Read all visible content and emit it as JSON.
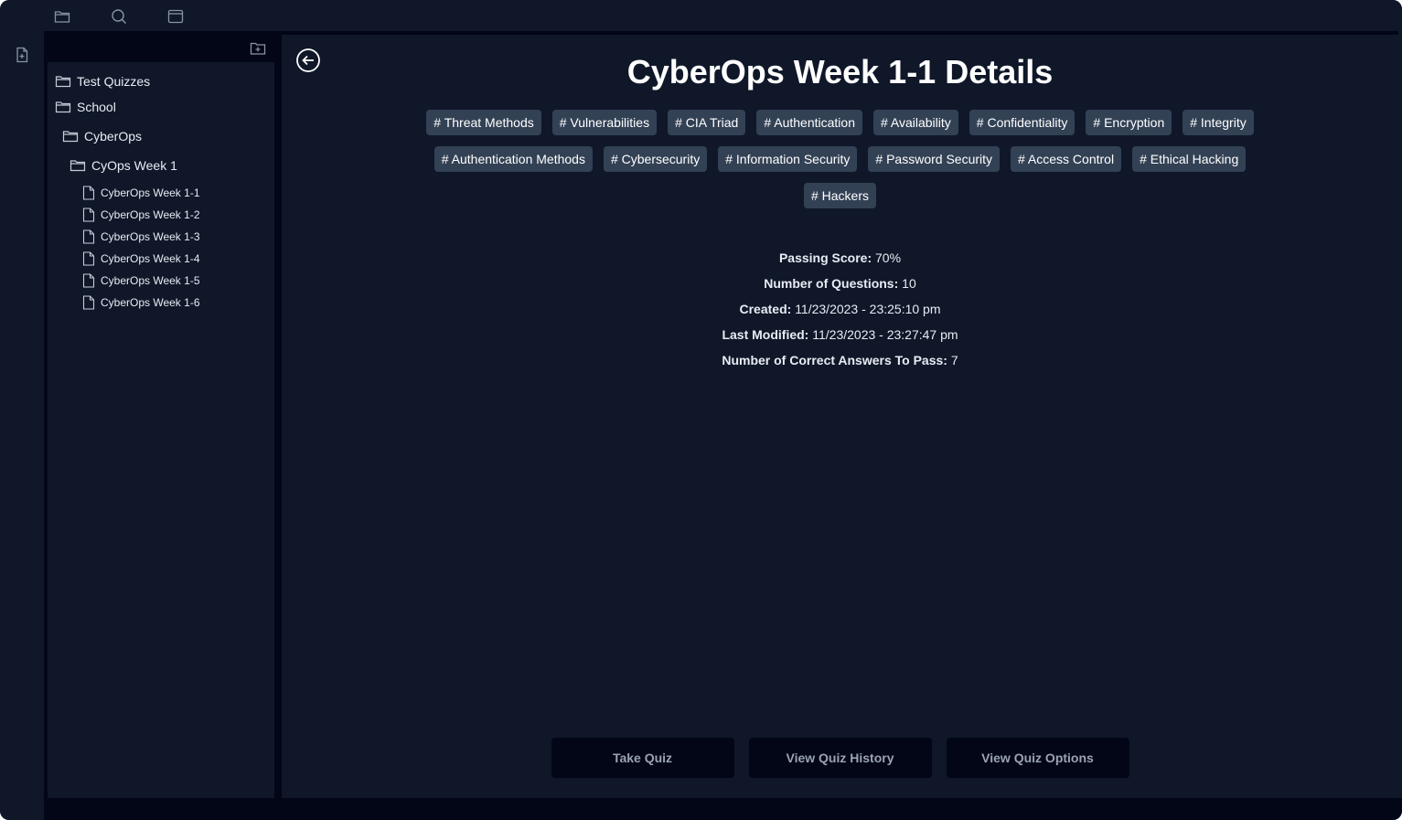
{
  "toolbar": {
    "icons": [
      "folder-icon",
      "search-icon",
      "calendar-icon"
    ]
  },
  "left_rail": {
    "icons": [
      "new-file-icon"
    ]
  },
  "sidebar": {
    "tree": [
      {
        "label": "Test Quizzes",
        "type": "folder",
        "level": 0
      },
      {
        "label": "School",
        "type": "folder",
        "level": 0
      },
      {
        "label": "CyberOps",
        "type": "folder",
        "level": 1
      },
      {
        "label": "CyOps Week 1",
        "type": "folder",
        "level": 2
      },
      {
        "label": "CyberOps Week 1-1",
        "type": "file",
        "level": 3
      },
      {
        "label": "CyberOps Week 1-2",
        "type": "file",
        "level": 3
      },
      {
        "label": "CyberOps Week 1-3",
        "type": "file",
        "level": 3
      },
      {
        "label": "CyberOps Week 1-4",
        "type": "file",
        "level": 3
      },
      {
        "label": "CyberOps Week 1-5",
        "type": "file",
        "level": 3
      },
      {
        "label": "CyberOps Week 1-6",
        "type": "file",
        "level": 3
      }
    ]
  },
  "main": {
    "title": "CyberOps Week 1-1 Details",
    "tags_row1": [
      "# Threat Methods",
      "# Vulnerabilities",
      "# CIA Triad",
      "# Authentication",
      "# Availability",
      "# Confidentiality",
      "# Encryption",
      "# Integrity"
    ],
    "tags_row2": [
      "# Authentication Methods",
      "# Cybersecurity",
      "# Information Security",
      "# Password Security",
      "# Access Control",
      "# Ethical Hacking"
    ],
    "tags_row3": [
      "# Hackers"
    ],
    "details": [
      {
        "label": "Passing Score:",
        "value": "70%"
      },
      {
        "label": "Number of Questions:",
        "value": "10"
      },
      {
        "label": "Created:",
        "value": "11/23/2023 - 23:25:10 pm"
      },
      {
        "label": "Last Modified:",
        "value": "11/23/2023 - 23:27:47 pm"
      },
      {
        "label": "Number of Correct Answers To Pass:",
        "value": "7"
      }
    ],
    "buttons": {
      "take_quiz": "Take Quiz",
      "view_history": "View Quiz History",
      "view_options": "View Quiz Options"
    }
  },
  "colors": {
    "background": "#0f1729",
    "panel_dark": "#020617",
    "tag_bg": "#334155",
    "text": "#ffffff"
  }
}
